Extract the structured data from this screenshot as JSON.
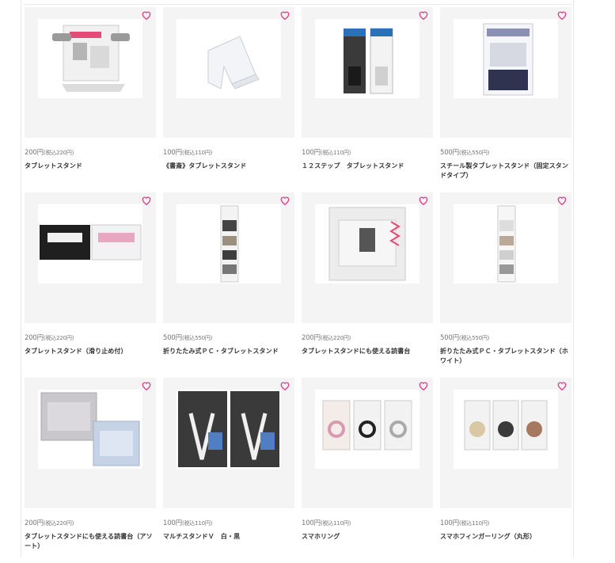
{
  "products": [
    {
      "price": "200円",
      "tax": "(税込220円)",
      "name": "タブレットスタンド",
      "save_badge": "保存"
    },
    {
      "price": "100円",
      "tax": "(税込110円)",
      "name": "《書斎》タブレットスタンド"
    },
    {
      "price": "100円",
      "tax": "(税込110円)",
      "name": "１２ステップ　タブレットスタンド"
    },
    {
      "price": "500円",
      "tax": "(税込550円)",
      "name": "スチール製タブレットスタンド（固定スタンドタイプ）"
    },
    {
      "price": "200円",
      "tax": "(税込220円)",
      "name": "タブレットスタンド（滑り止め付）"
    },
    {
      "price": "500円",
      "tax": "(税込550円)",
      "name": "折りたたみ式ＰＣ・タブレットスタンド"
    },
    {
      "price": "200円",
      "tax": "(税込220円)",
      "name": "タブレットスタンドにも使える読書台"
    },
    {
      "price": "500円",
      "tax": "(税込550円)",
      "name": "折りたたみ式ＰＣ・タブレットスタンド（ホワイト）"
    },
    {
      "price": "200円",
      "tax": "(税込220円)",
      "name": "タブレットスタンドにも使える読書台（アソート）"
    },
    {
      "price": "100円",
      "tax": "(税込110円)",
      "name": "マルチスタンドＶ　白・黒"
    },
    {
      "price": "100円",
      "tax": "(税込110円)",
      "name": "スマホリング"
    },
    {
      "price": "100円",
      "tax": "(税込110円)",
      "name": "スマホフィンガーリング（丸形）"
    }
  ],
  "colors": {
    "heart": "#e8428c",
    "accent": "#e60023"
  },
  "icons": {
    "favorite": "heart-outline-icon"
  }
}
